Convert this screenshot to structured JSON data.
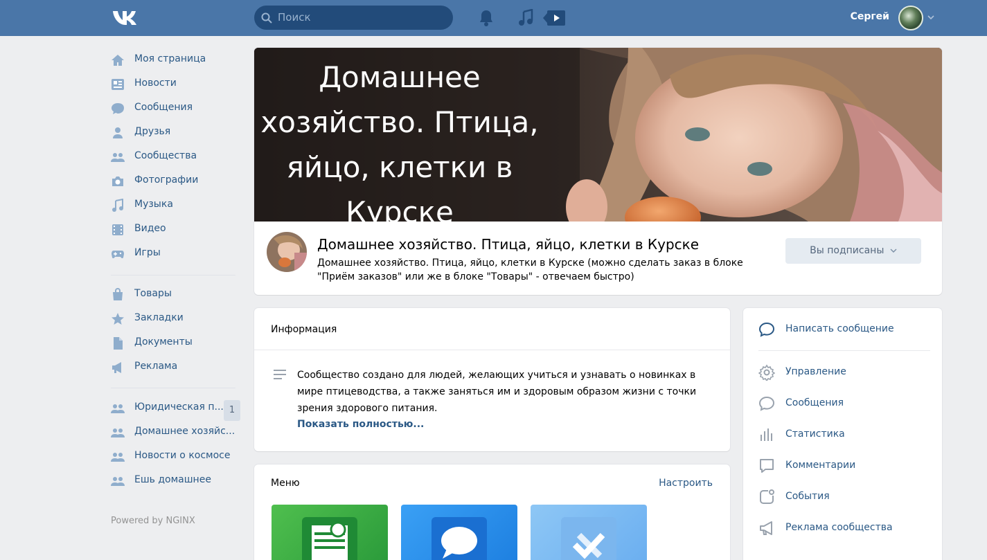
{
  "header": {
    "search_placeholder": "Поиск",
    "user_name": "Сергей"
  },
  "sidebar": {
    "items": [
      {
        "label": "Моя страница",
        "icon": "home-icon"
      },
      {
        "label": "Новости",
        "icon": "news-icon"
      },
      {
        "label": "Сообщения",
        "icon": "messages-icon"
      },
      {
        "label": "Друзья",
        "icon": "friends-icon"
      },
      {
        "label": "Сообщества",
        "icon": "communities-icon"
      },
      {
        "label": "Фотографии",
        "icon": "camera-icon"
      },
      {
        "label": "Музыка",
        "icon": "music-icon"
      },
      {
        "label": "Видео",
        "icon": "video-icon"
      },
      {
        "label": "Игры",
        "icon": "gamepad-icon"
      }
    ],
    "items2": [
      {
        "label": "Товары",
        "icon": "shopping-bag-icon"
      },
      {
        "label": "Закладки",
        "icon": "star-icon"
      },
      {
        "label": "Документы",
        "icon": "document-icon"
      },
      {
        "label": "Реклама",
        "icon": "megaphone-icon"
      }
    ],
    "groups": [
      {
        "label": "Юридическая п...",
        "badge": "1"
      },
      {
        "label": "Домашнее хозяйс..."
      },
      {
        "label": "Новости о космосе"
      },
      {
        "label": "Ешь домашнее"
      }
    ],
    "powered_by": "Powered by NGINX"
  },
  "group": {
    "cover_text": "Домашнее хозяйство. Птица, яйцо, клетки в Курске",
    "title": "Домашнее хозяйство. Птица, яйцо, клетки в Курске",
    "status": "Домашнее хозяйство. Птица, яйцо, клетки в Курске (можно сделать заказ в блоке \"Приём заказов\" или же в блоке \"Товары\" - отвечаем быстро)",
    "subscribe_label": "Вы подписаны"
  },
  "info": {
    "header": "Информация",
    "text": "Сообщество создано для людей, желающих учиться и узнавать о новинках в мире птицеводства, а также заняться им и здоровым образом жизни с точки зрения здорового питания.",
    "show_more": "Показать полностью..."
  },
  "menu": {
    "header": "Меню",
    "configure": "Настроить"
  },
  "actions": {
    "write_message": "Написать сообщение",
    "items": [
      {
        "label": "Управление",
        "icon": "gear-icon"
      },
      {
        "label": "Сообщения",
        "icon": "message-bubble-icon"
      },
      {
        "label": "Статистика",
        "icon": "bar-chart-icon"
      },
      {
        "label": "Комментарии",
        "icon": "comment-icon"
      },
      {
        "label": "События",
        "icon": "event-icon"
      },
      {
        "label": "Реклама сообщества",
        "icon": "megaphone-icon"
      }
    ]
  },
  "colors": {
    "header_bg": "#4a76a8",
    "link": "#2a5885",
    "page_bg": "#edeef0"
  }
}
